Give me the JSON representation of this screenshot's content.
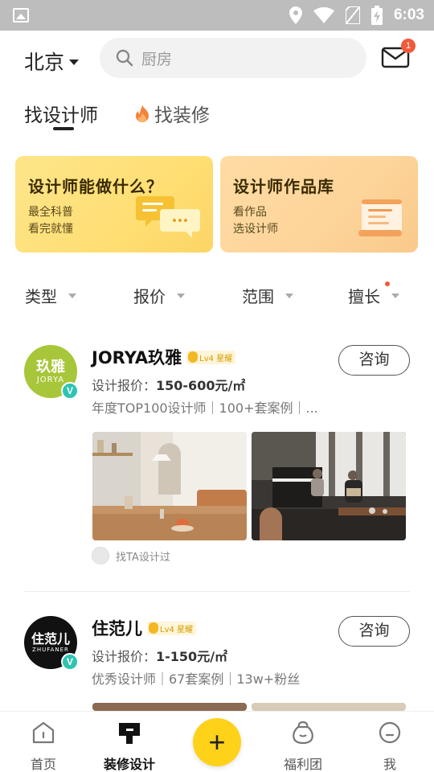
{
  "status_bar": {
    "time": "6:03"
  },
  "header": {
    "city": "北京",
    "search_placeholder": "厨房",
    "mail_badge": "1"
  },
  "tabs": [
    {
      "label": "找设计师",
      "active": true
    },
    {
      "label": "找装修",
      "active": false
    }
  ],
  "banners": [
    {
      "title": "设计师能做什么？",
      "line1": "最全科普",
      "line2": "看完就懂"
    },
    {
      "title": "设计师作品库",
      "line1": "看作品",
      "line2": "选设计师"
    }
  ],
  "filters": [
    "类型",
    "报价",
    "范围",
    "擅长"
  ],
  "designers": [
    {
      "name": "JORYA玖雅",
      "level": "Lv4 星耀",
      "avatar_line1": "玖雅",
      "avatar_line2": "JORYA",
      "price_label": "设计报价：",
      "price_value": "150-600元/㎡",
      "tags": "年度TOP100设计师｜100+套案例｜...",
      "consult": "咨询",
      "found_by": "找TA设计过"
    },
    {
      "name": "住范儿",
      "level": "Lv4 星耀",
      "avatar_line1": "住范儿",
      "avatar_line2": "ZHUFANER",
      "price_label": "设计报价：",
      "price_value": "1-150元/㎡",
      "tags": "优秀设计师｜67套案例｜13w+粉丝",
      "consult": "咨询"
    }
  ],
  "bottom_nav": [
    {
      "label": "首页",
      "icon": "home-icon"
    },
    {
      "label": "装修设计",
      "icon": "design-icon",
      "active": true
    },
    {
      "label": "+",
      "icon": "plus-icon"
    },
    {
      "label": "福利团",
      "icon": "gift-bag-icon"
    },
    {
      "label": "我",
      "icon": "profile-icon"
    }
  ],
  "colors": {
    "accent_yellow": "#ffd21a",
    "badge_red": "#f05a3a",
    "verified_teal": "#2fc4b2",
    "status_bar": "#bdbdbd"
  }
}
